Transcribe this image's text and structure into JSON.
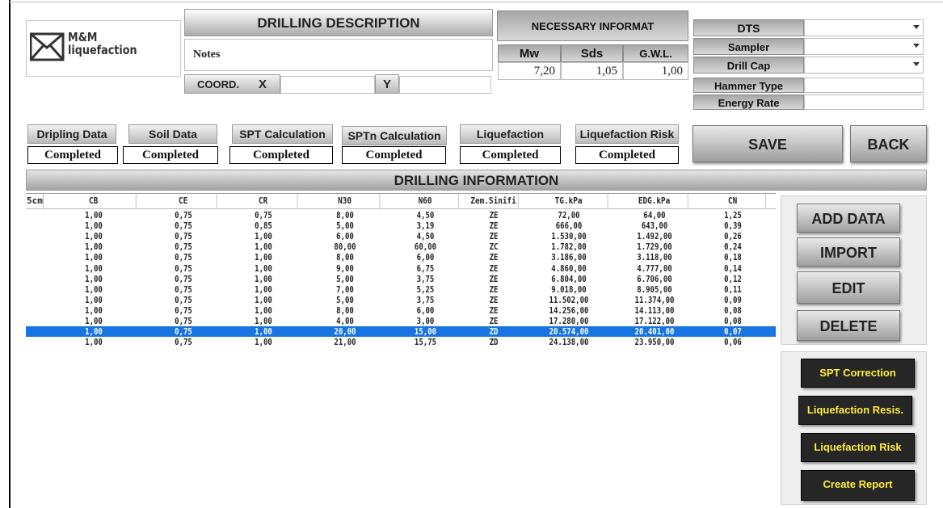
{
  "logo": {
    "line1": "M&M",
    "line2": "liquefaction"
  },
  "drilling_description": {
    "title": "DRILLING DESCRIPTION",
    "notes_label": "Notes",
    "coord_label": "COORD.",
    "x_label": "X",
    "y_label": "Y",
    "x_value": "",
    "y_value": ""
  },
  "necessary_info": {
    "title": "NECESSARY INFORMAT",
    "mw_label": "Mw",
    "sds_label": "Sds",
    "gwl_label": "G.W.L.",
    "mw_value": "7,20",
    "sds_value": "1,05",
    "gwl_value": "1,00"
  },
  "params": {
    "dts": "DTS",
    "sampler": "Sampler",
    "drill_cap": "Drill Cap",
    "hammer_type": "Hammer Type",
    "energy_rate": "Energy Rate"
  },
  "tabs": [
    {
      "label": "Dripling Data",
      "status": "Completed"
    },
    {
      "label": "Soil Data",
      "status": "Completed"
    },
    {
      "label": "SPT Calculation",
      "status": "Completed"
    },
    {
      "label": "SPTn Calculation",
      "status": "Completed"
    },
    {
      "label": "Liquefaction",
      "status": "Completed"
    },
    {
      "label": "Liquefaction Risk",
      "status": "Completed"
    }
  ],
  "buttons": {
    "save": "SAVE",
    "back": "BACK",
    "add_data": "ADD DATA",
    "import": "IMPORT",
    "edit": "EDIT",
    "delete": "DELETE",
    "spt_correction": "SPT Correction",
    "liq_resis": "Liquefaction Resis.",
    "liq_risk": "Liquefaction Risk",
    "create_report": "Create Report"
  },
  "drilling_info_title": "DRILLING INFORMATION",
  "table": {
    "columns": [
      "5cm",
      "CB",
      "CE",
      "CR",
      "N30",
      "N60",
      "Zem.Sinifi",
      "TG.kPa",
      "EDG.kPa",
      "CN"
    ],
    "selected_row": 11,
    "rows": [
      [
        "",
        "1,00",
        "0,75",
        "0,75",
        "8,00",
        "4,50",
        "ZE",
        "72,00",
        "64,00",
        "1,25"
      ],
      [
        "",
        "1,00",
        "0,75",
        "0,85",
        "5,00",
        "3,19",
        "ZE",
        "666,00",
        "643,00",
        "0,39"
      ],
      [
        "",
        "1,00",
        "0,75",
        "1,00",
        "6,00",
        "4,50",
        "ZE",
        "1.530,00",
        "1.492,00",
        "0,26"
      ],
      [
        "",
        "1,00",
        "0,75",
        "1,00",
        "80,00",
        "60,00",
        "ZC",
        "1.782,00",
        "1.729,00",
        "0,24"
      ],
      [
        "",
        "1,00",
        "0,75",
        "1,00",
        "8,00",
        "6,00",
        "ZE",
        "3.186,00",
        "3.118,00",
        "0,18"
      ],
      [
        "",
        "1,00",
        "0,75",
        "1,00",
        "9,00",
        "6,75",
        "ZE",
        "4.860,00",
        "4.777,00",
        "0,14"
      ],
      [
        "",
        "1,00",
        "0,75",
        "1,00",
        "5,00",
        "3,75",
        "ZE",
        "6.804,00",
        "6.706,00",
        "0,12"
      ],
      [
        "",
        "1,00",
        "0,75",
        "1,00",
        "7,00",
        "5,25",
        "ZE",
        "9.018,00",
        "8.905,00",
        "0,11"
      ],
      [
        "",
        "1,00",
        "0,75",
        "1,00",
        "5,00",
        "3,75",
        "ZE",
        "11.502,00",
        "11.374,00",
        "0,09"
      ],
      [
        "",
        "1,00",
        "0,75",
        "1,00",
        "8,00",
        "6,00",
        "ZE",
        "14.256,00",
        "14.113,00",
        "0,08"
      ],
      [
        "",
        "1,00",
        "0,75",
        "1,00",
        "4,00",
        "3,00",
        "ZE",
        "17.280,00",
        "17.122,00",
        "0,08"
      ],
      [
        "",
        "1,00",
        "0,75",
        "1,00",
        "20,00",
        "15,00",
        "ZD",
        "20.574,00",
        "20.401,00",
        "0,07"
      ],
      [
        "",
        "1,00",
        "0,75",
        "1,00",
        "21,00",
        "15,75",
        "ZD",
        "24.138,00",
        "23.950,00",
        "0,06"
      ]
    ]
  },
  "colors": {
    "selection": "#1874e0",
    "dark_button_text": "#ffee3a"
  }
}
